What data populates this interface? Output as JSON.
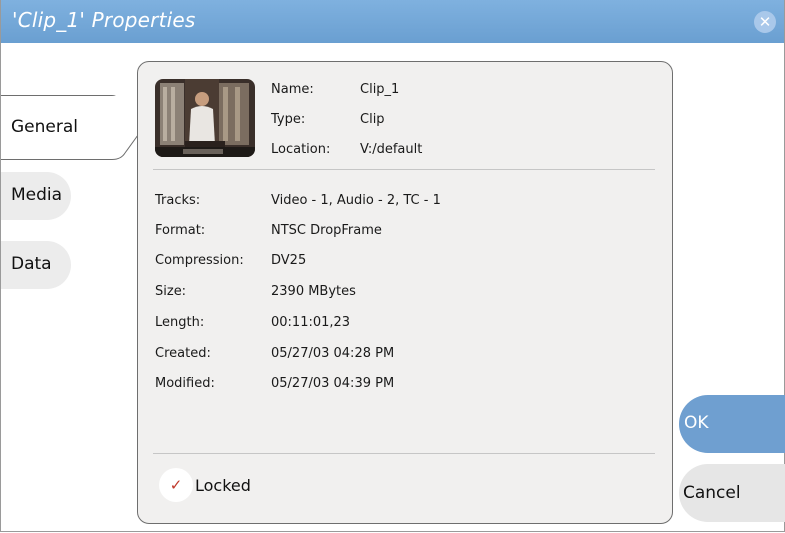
{
  "window": {
    "title": "'Clip_1' Properties"
  },
  "tabs": [
    "General",
    "Media",
    "Data"
  ],
  "active_tab": "General",
  "header_fields": [
    {
      "label": "Name:",
      "value": "Clip_1"
    },
    {
      "label": "Type:",
      "value": "Clip"
    },
    {
      "label": "Location:",
      "value": "V:/default"
    }
  ],
  "details": [
    {
      "label": "Tracks:",
      "value": "Video - 1, Audio - 2, TC - 1"
    },
    {
      "label": "Format:",
      "value": "NTSC DropFrame"
    },
    {
      "label": "Compression:",
      "value": "DV25"
    },
    {
      "label": "Size:",
      "value": "2390 MBytes"
    },
    {
      "label": "Length:",
      "value": "00:11:01,23"
    },
    {
      "label": "Created:",
      "value": "05/27/03 04:28 PM"
    },
    {
      "label": "Modified:",
      "value": "05/27/03 04:39 PM"
    }
  ],
  "locked": {
    "label": "Locked",
    "checked": true
  },
  "buttons": {
    "ok": "OK",
    "cancel": "Cancel"
  },
  "icons": {
    "close": "close-icon",
    "check": "checkmark-icon",
    "thumbnail": "clip-thumbnail"
  },
  "colors": {
    "titlebar": "#6a9fd1",
    "ok_button": "#6f9fd0",
    "panel": "#f1f0ef",
    "inactive_tab": "#ececec"
  }
}
